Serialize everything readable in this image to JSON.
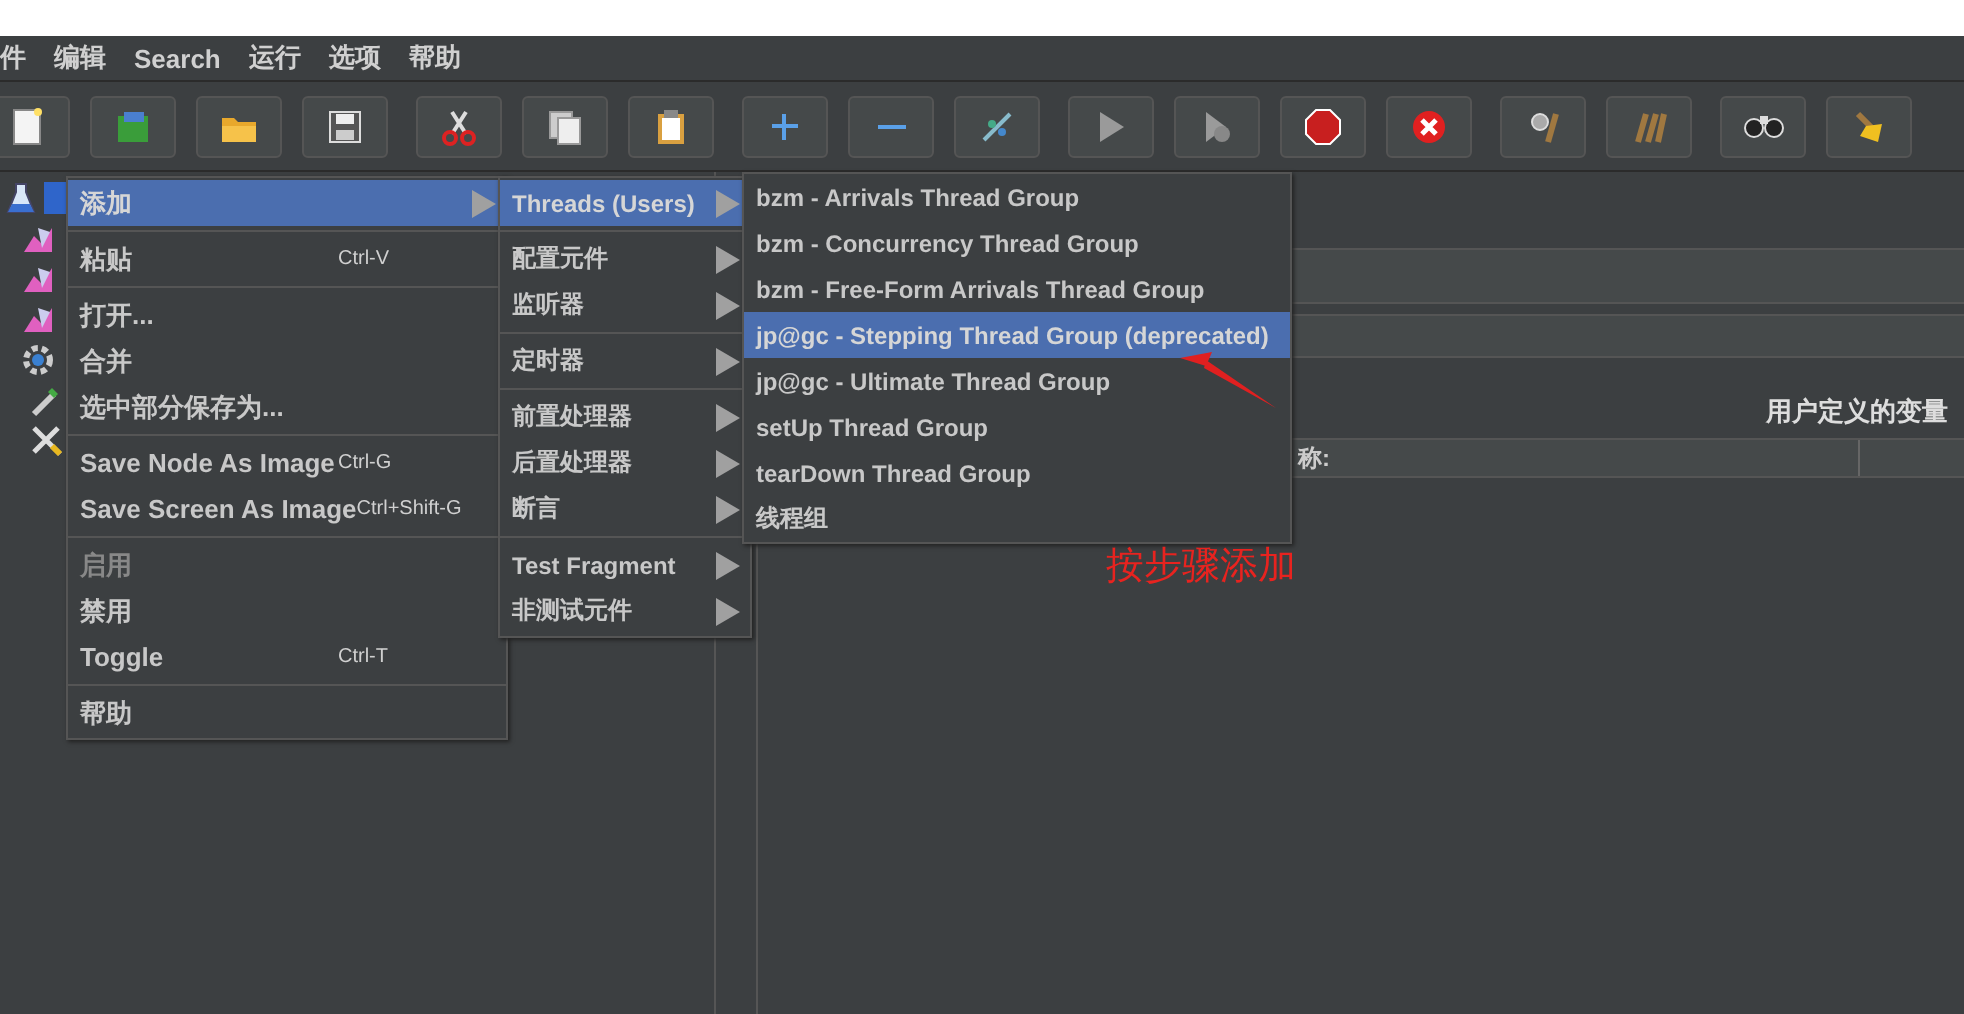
{
  "menubar": [
    {
      "label": "件"
    },
    {
      "label": "编辑"
    },
    {
      "label": "Search"
    },
    {
      "label": "运行"
    },
    {
      "label": "选项"
    },
    {
      "label": "帮助"
    }
  ],
  "toolbar": [
    {
      "kind": "new"
    },
    {
      "kind": "templates"
    },
    {
      "kind": "open"
    },
    {
      "kind": "save"
    },
    {
      "kind": "cut"
    },
    {
      "kind": "copy"
    },
    {
      "kind": "paste"
    },
    {
      "kind": "add"
    },
    {
      "kind": "remove"
    },
    {
      "kind": "toggle"
    },
    {
      "kind": "start"
    },
    {
      "kind": "start-no-pause"
    },
    {
      "kind": "stop"
    },
    {
      "kind": "shutdown"
    },
    {
      "kind": "clear"
    },
    {
      "kind": "clear-all"
    },
    {
      "kind": "search"
    },
    {
      "kind": "reset"
    }
  ],
  "tree": {
    "items": [
      {
        "kind": "plan",
        "selected": true
      },
      {
        "kind": "listener",
        "selected": false
      },
      {
        "kind": "listener",
        "selected": false
      },
      {
        "kind": "listener",
        "selected": false
      },
      {
        "kind": "threads",
        "selected": false
      },
      {
        "kind": "sampler",
        "selected": false
      },
      {
        "kind": "tools",
        "selected": false
      }
    ]
  },
  "panel": {
    "section_label": "用户定义的变量",
    "table": {
      "columns": [
        {
          "label": "称:"
        },
        {}
      ]
    }
  },
  "context_menu": {
    "items": [
      {
        "kind": "item",
        "label": "添加",
        "submenu": true,
        "selected": true,
        "disabled": false
      },
      {
        "kind": "separator"
      },
      {
        "kind": "item",
        "label": "粘贴",
        "shortcut": "Ctrl-V",
        "submenu": false,
        "selected": false,
        "disabled": false
      },
      {
        "kind": "separator"
      },
      {
        "kind": "item",
        "label": "打开...",
        "submenu": false,
        "selected": false,
        "disabled": false
      },
      {
        "kind": "item",
        "label": "合并",
        "submenu": false,
        "selected": false,
        "disabled": false
      },
      {
        "kind": "item",
        "label": "选中部分保存为...",
        "submenu": false,
        "selected": false,
        "disabled": false
      },
      {
        "kind": "separator"
      },
      {
        "kind": "item",
        "label": "Save Node As Image",
        "shortcut": "Ctrl-G",
        "submenu": false,
        "selected": false,
        "disabled": false
      },
      {
        "kind": "item",
        "label": "Save Screen As Image",
        "shortcut": "Ctrl+Shift-G",
        "submenu": false,
        "selected": false,
        "disabled": false
      },
      {
        "kind": "separator"
      },
      {
        "kind": "item",
        "label": "启用",
        "submenu": false,
        "selected": false,
        "disabled": true
      },
      {
        "kind": "item",
        "label": "禁用",
        "submenu": false,
        "selected": false,
        "disabled": false
      },
      {
        "kind": "item",
        "label": "Toggle",
        "shortcut": "Ctrl-T",
        "submenu": false,
        "selected": false,
        "disabled": false
      },
      {
        "kind": "separator"
      },
      {
        "kind": "item",
        "label": "帮助",
        "submenu": false,
        "selected": false,
        "disabled": false
      }
    ]
  },
  "add_submenu": {
    "items": [
      {
        "kind": "item",
        "label": "Threads (Users)",
        "submenu": true,
        "selected": true
      },
      {
        "kind": "separator"
      },
      {
        "kind": "item",
        "label": "配置元件",
        "submenu": true,
        "selected": false
      },
      {
        "kind": "item",
        "label": "监听器",
        "submenu": true,
        "selected": false
      },
      {
        "kind": "separator"
      },
      {
        "kind": "item",
        "label": "定时器",
        "submenu": true,
        "selected": false
      },
      {
        "kind": "separator"
      },
      {
        "kind": "item",
        "label": "前置处理器",
        "submenu": true,
        "selected": false
      },
      {
        "kind": "item",
        "label": "后置处理器",
        "submenu": true,
        "selected": false
      },
      {
        "kind": "item",
        "label": "断言",
        "submenu": true,
        "selected": false
      },
      {
        "kind": "separator"
      },
      {
        "kind": "item",
        "label": "Test Fragment",
        "submenu": true,
        "selected": false
      },
      {
        "kind": "item",
        "label": "非测试元件",
        "submenu": true,
        "selected": false
      }
    ]
  },
  "threads_submenu": {
    "items": [
      {
        "kind": "item",
        "label": "bzm - Arrivals Thread Group",
        "selected": false
      },
      {
        "kind": "item",
        "label": "bzm - Concurrency Thread Group",
        "selected": false
      },
      {
        "kind": "item",
        "label": "bzm - Free-Form Arrivals Thread Group",
        "selected": false
      },
      {
        "kind": "item",
        "label": "jp@gc - Stepping Thread Group (deprecated)",
        "selected": true
      },
      {
        "kind": "item",
        "label": "jp@gc - Ultimate Thread Group",
        "selected": false
      },
      {
        "kind": "item",
        "label": "setUp Thread Group",
        "selected": false
      },
      {
        "kind": "item",
        "label": "tearDown Thread Group",
        "selected": false
      },
      {
        "kind": "item",
        "label": "线程组",
        "selected": false
      }
    ]
  },
  "annotation": {
    "text": "按步骤添加"
  }
}
